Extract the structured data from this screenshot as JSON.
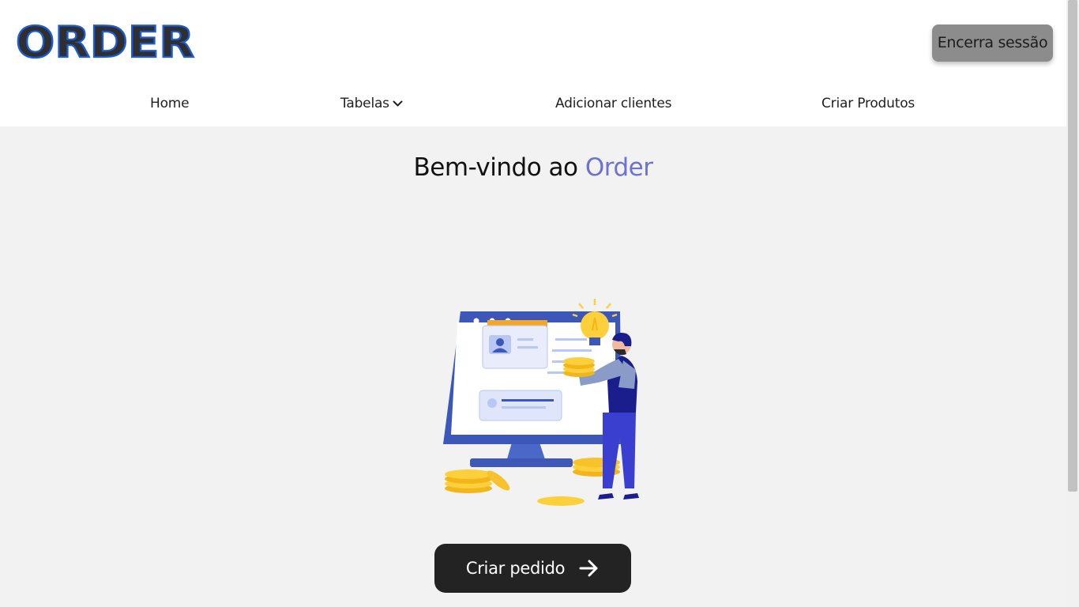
{
  "header": {
    "logo_text": "ORDER",
    "logout_label": "Encerra sessão"
  },
  "nav": {
    "items": [
      {
        "label": "Home"
      },
      {
        "label": "Tabelas",
        "icon": "chevron-down-icon"
      },
      {
        "label": "Adicionar clientes"
      },
      {
        "label": "Criar Produtos"
      }
    ]
  },
  "main": {
    "welcome_prefix": "Bem-vindo ao ",
    "welcome_brand": "Order",
    "illustration": "person-with-computer-and-coins-illustration",
    "cta_label": "Criar pedido",
    "cta_icon": "arrow-right-icon"
  },
  "colors": {
    "brand_purple": "#6c72cf",
    "logo_blue": "#1b5bd6",
    "logo_fill": "#2f2f2f",
    "button_dark": "#232323",
    "logout_gray": "#8c8c8c"
  }
}
